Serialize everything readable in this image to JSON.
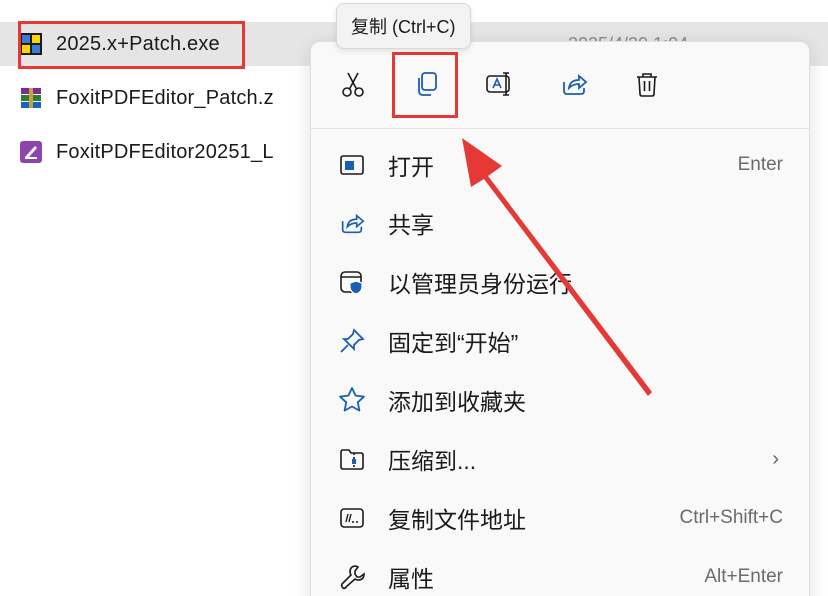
{
  "files": [
    {
      "name": "2025.x+Patch.exe",
      "date": "2025/4/29 1:04",
      "icon": "patch-exe-icon",
      "selected": true
    },
    {
      "name": "FoxitPDFEditor_Patch.z",
      "icon": "winrar-archive-icon"
    },
    {
      "name": "FoxitPDFEditor20251_L",
      "icon": "foxit-installer-icon"
    }
  ],
  "tooltip": {
    "text": "复制 (Ctrl+C)"
  },
  "toolbar": [
    {
      "icon": "scissors-icon",
      "action": "cut"
    },
    {
      "icon": "copy-icon",
      "action": "copy"
    },
    {
      "icon": "rename-icon",
      "action": "rename"
    },
    {
      "icon": "share-icon",
      "action": "share"
    },
    {
      "icon": "trash-icon",
      "action": "delete"
    }
  ],
  "menu": {
    "items": [
      {
        "label": "打开",
        "shortcut": "Enter",
        "icon": "open-window-icon"
      },
      {
        "label": "共享",
        "shortcut": "",
        "icon": "share-icon"
      },
      {
        "label": "以管理员身份运行",
        "shortcut": "",
        "icon": "admin-shield-icon"
      },
      {
        "label": "固定到“开始”",
        "shortcut": "",
        "icon": "pin-icon"
      },
      {
        "label": "添加到收藏夹",
        "shortcut": "",
        "icon": "star-icon"
      },
      {
        "label": "压缩到...",
        "shortcut": "",
        "icon": "zip-folder-icon",
        "submenu": true
      },
      {
        "label": "复制文件地址",
        "shortcut": "Ctrl+Shift+C",
        "icon": "copy-path-icon"
      },
      {
        "label": "属性",
        "shortcut": "Alt+Enter",
        "icon": "wrench-icon"
      }
    ]
  },
  "colors": {
    "annotation": "#e53935",
    "icon_blue": "#1a5fb4",
    "selection": "#e5e5e5"
  }
}
